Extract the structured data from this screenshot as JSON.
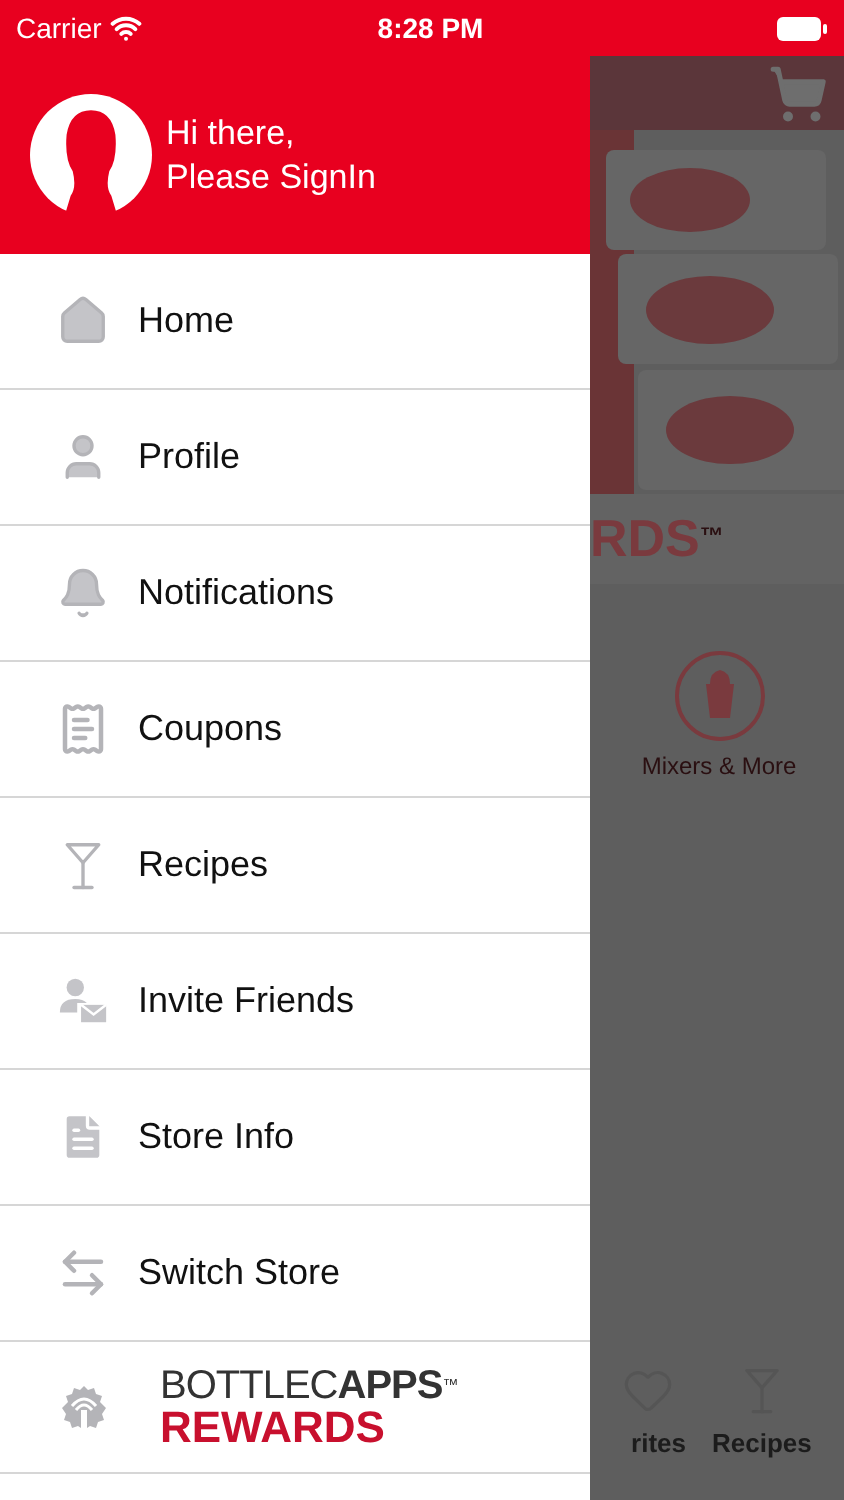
{
  "status_bar": {
    "carrier": "Carrier",
    "time": "8:28 PM"
  },
  "drawer": {
    "greeting": "Hi there,",
    "prompt": "Please SignIn",
    "items": [
      {
        "label": "Home",
        "kind": "home"
      },
      {
        "label": "Profile",
        "kind": "user"
      },
      {
        "label": "Notifications",
        "kind": "bell"
      },
      {
        "label": "Coupons",
        "kind": "coupon"
      },
      {
        "label": "Recipes",
        "kind": "cocktail"
      },
      {
        "label": "Invite Friends",
        "kind": "invite"
      },
      {
        "label": "Store Info",
        "kind": "document"
      },
      {
        "label": "Switch Store",
        "kind": "switch"
      }
    ],
    "footer": {
      "brand_light": "BOTTLEC",
      "brand_bold": "APPS",
      "trademark": "™",
      "brand_bottom": "REWARDS"
    }
  },
  "background": {
    "banner_text": "RDS",
    "banner_trademark": "™",
    "category": "Mixers & More",
    "tabs": [
      {
        "label": "rites",
        "kind": "heart"
      },
      {
        "label": "Recipes",
        "kind": "cocktail"
      }
    ]
  }
}
